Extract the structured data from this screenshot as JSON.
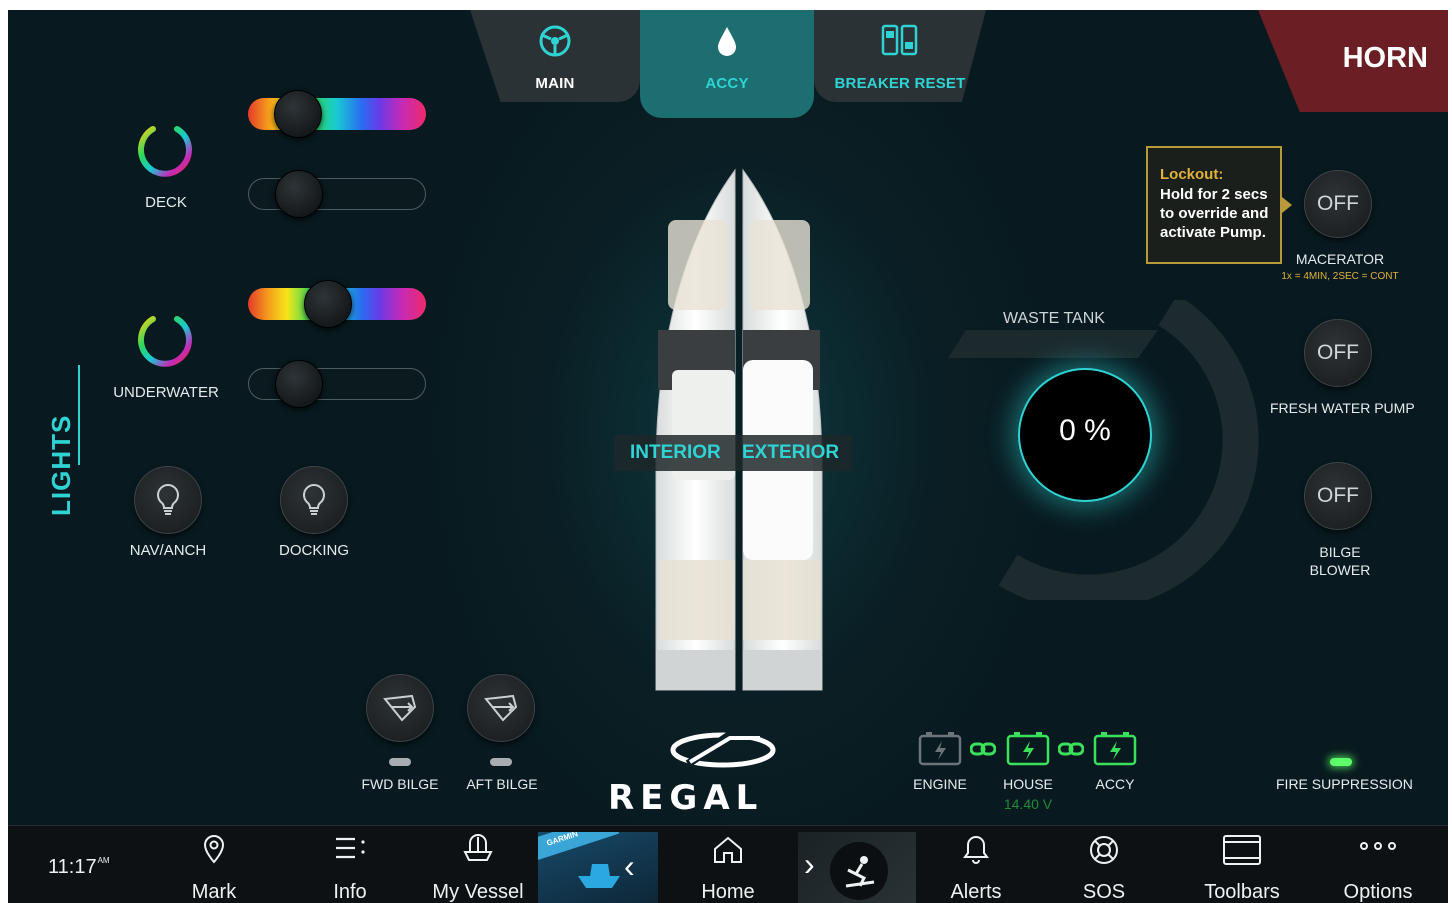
{
  "tabs": {
    "main": "MAIN",
    "accy": "ACCY",
    "breaker": "BREAKER RESET",
    "horn": "HORN"
  },
  "lights": {
    "section_label": "LIGHTS",
    "deck": {
      "label": "DECK",
      "color_level": 0.2,
      "brightness_level": 0.2
    },
    "underwater": {
      "label": "UNDERWATER",
      "color_level": 0.43,
      "brightness_level": 0.2
    },
    "nav_anch": "NAV/ANCH",
    "docking": "DOCKING"
  },
  "boat": {
    "interior": "INTERIOR",
    "exterior": "EXTERIOR",
    "brand": "REGAL"
  },
  "pumps": {
    "fwd_bilge": "FWD BILGE",
    "aft_bilge": "AFT BILGE"
  },
  "waste_tank": {
    "label": "WASTE TANK",
    "value": "0 %"
  },
  "right_controls": {
    "lockout_title": "Lockout:",
    "lockout_text": "Hold for 2 secs to override and activate Pump.",
    "macerator": {
      "state": "OFF",
      "label": "MACERATOR",
      "hint": "1x = 4MIN, 2SEC = CONT"
    },
    "fresh_water": {
      "state": "OFF",
      "label": "FRESH WATER PUMP"
    },
    "bilge_blower": {
      "state": "OFF",
      "label_line1": "BILGE",
      "label_line2": "BLOWER"
    },
    "fire_suppression": "FIRE SUPPRESSION"
  },
  "batteries": {
    "engine": "ENGINE",
    "house": "HOUSE",
    "house_voltage": "14.40 V",
    "accy": "ACCY"
  },
  "bottom_bar": {
    "time": "11:17",
    "time_suffix": "AM",
    "mark": "Mark",
    "info": "Info",
    "my_vessel": "My Vessel",
    "garmin": "GARMIN",
    "home": "Home",
    "alerts": "Alerts",
    "sos": "SOS",
    "toolbars": "Toolbars",
    "options": "Options"
  },
  "colors": {
    "accent": "#2fd3d3",
    "horn": "#6b1f24",
    "battery_green": "#3be05a",
    "lockout_border": "#b89a3a"
  }
}
